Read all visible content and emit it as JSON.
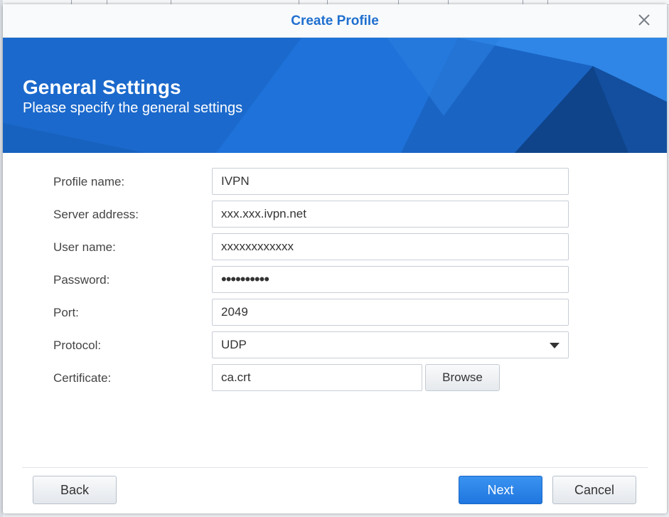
{
  "dialog": {
    "title": "Create Profile",
    "close_icon": "close-icon"
  },
  "banner": {
    "title": "General Settings",
    "subtitle": "Please specify the general settings",
    "color": "#1c6fd6"
  },
  "form": {
    "profile_name": {
      "label": "Profile name:",
      "value": "IVPN"
    },
    "server_address": {
      "label": "Server address:",
      "value": "xxx.xxx.ivpn.net"
    },
    "user_name": {
      "label": "User name:",
      "value": "xxxxxxxxxxxx"
    },
    "password": {
      "label": "Password:",
      "value": "••••••••••"
    },
    "port": {
      "label": "Port:",
      "value": "2049"
    },
    "protocol": {
      "label": "Protocol:",
      "value": "UDP",
      "icon": "chevron-down-icon"
    },
    "certificate": {
      "label": "Certificate:",
      "value": "ca.crt",
      "browse_label": "Browse"
    }
  },
  "footer": {
    "back_label": "Back",
    "next_label": "Next",
    "cancel_label": "Cancel",
    "accent": "#1f77e0"
  }
}
